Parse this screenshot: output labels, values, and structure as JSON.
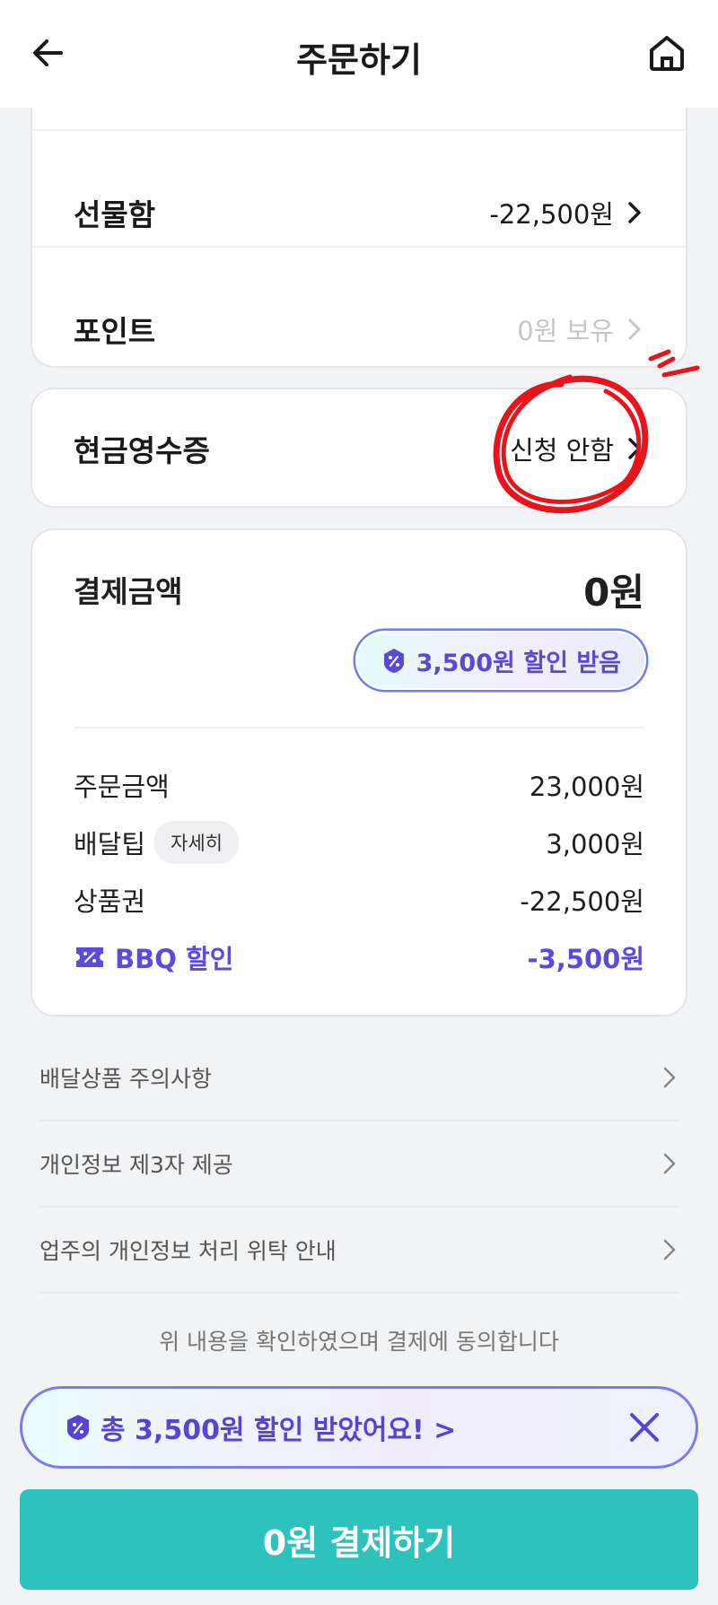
{
  "header": {
    "title": "주문하기",
    "back_icon": "arrow-left-icon",
    "home_icon": "home-icon"
  },
  "payment_methods": {
    "gift_box": {
      "label": "선물함",
      "value": "-22,500원"
    },
    "points": {
      "label": "포인트",
      "value": "0원 보유"
    }
  },
  "cash_receipt": {
    "label": "현금영수증",
    "value": "신청 안함"
  },
  "payment_summary": {
    "title": "결제금액",
    "amount": "0원",
    "discount_pill": "3,500원 할인 받음",
    "lines": [
      {
        "label": "주문금액",
        "value": "23,000원"
      },
      {
        "label": "배달팁",
        "chip": "자세히",
        "value": "3,000원"
      },
      {
        "label": "상품권",
        "value": "-22,500원"
      },
      {
        "label": "BBQ 할인",
        "value": "-3,500원"
      }
    ]
  },
  "notices": [
    {
      "label": "배달상품 주의사항"
    },
    {
      "label": "개인정보 제3자 제공"
    },
    {
      "label": "업주의 개인정보 처리 위탁 안내"
    }
  ],
  "agreement_text": "위 내용을 확인하였으며 결제에 동의합니다",
  "discount_banner": {
    "text": "총 3,500원 할인 받았어요! >"
  },
  "pay_button": {
    "label": "0원 결제하기"
  },
  "colors": {
    "accent_teal": "#2dc2bc",
    "discount_purple": "#5b4bdb",
    "annotation_red": "#e8141c"
  }
}
